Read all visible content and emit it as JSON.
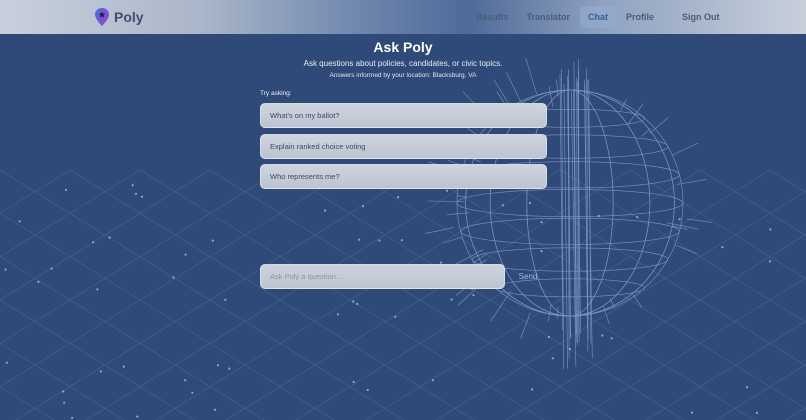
{
  "brand": {
    "name": "Poly"
  },
  "nav": {
    "items": [
      {
        "label": "Results"
      },
      {
        "label": "Translator"
      },
      {
        "label": "Chat",
        "active": true
      },
      {
        "label": "Profile"
      },
      {
        "label": "Sign Out"
      }
    ]
  },
  "hero": {
    "title": "Ask Poly",
    "subtitle": "Ask questions about policies, candidates, or civic topics.",
    "location": "Answers informed by your location: Blacksburg, VA"
  },
  "suggestions": {
    "label": "Try asking:",
    "items": [
      "What's on my ballot?",
      "Explain ranked choice voting",
      "Who represents me?"
    ]
  },
  "composer": {
    "placeholder": "Ask Poly a question...",
    "value": "",
    "send_label": "Send"
  },
  "colors": {
    "background": "#2f4a78",
    "accent": "#7a3fd6",
    "active_nav": "#3a5d95"
  }
}
